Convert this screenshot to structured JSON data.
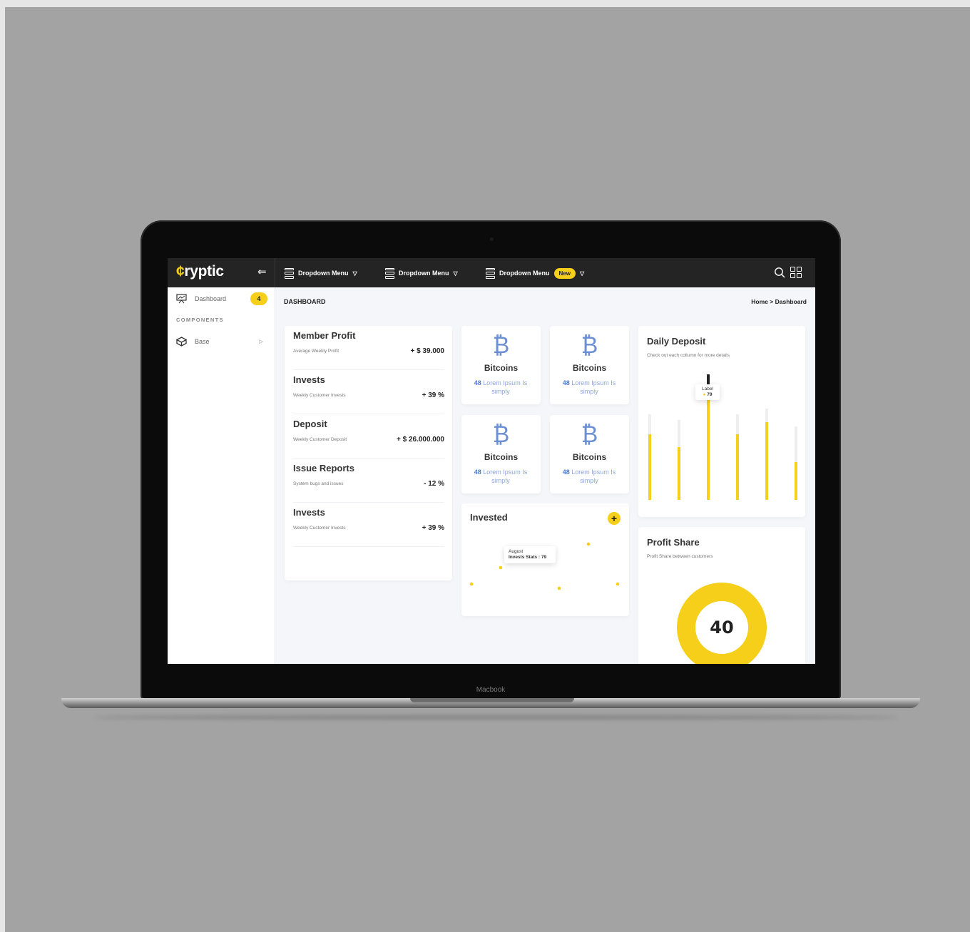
{
  "laptop": {
    "brand": "Macbook"
  },
  "colors": {
    "accent": "#f5cf1a",
    "topbar": "#242424",
    "bitcoin_blue": "#6c8fd4",
    "bar_track": "#eeeeee",
    "bar_selected": "#222222"
  },
  "topbar": {
    "logo_mark": "¢",
    "logo_text": "ryptic",
    "collapse_icon": "arrow-left-icon",
    "menus": [
      {
        "label": "Dropdown Menu",
        "icon": "menu-icon",
        "caret": "▽"
      },
      {
        "label": "Dropdown Menu",
        "icon": "menu-icon",
        "caret": "▽"
      },
      {
        "label": "Dropdown Menu",
        "icon": "menu-icon",
        "caret": "▽",
        "badge": "New"
      }
    ],
    "icons": [
      "search-icon",
      "grid-icon"
    ]
  },
  "sidebar": {
    "items": [
      {
        "label": "Dashboard",
        "icon": "dashboard-icon",
        "badge": "4"
      }
    ],
    "section": "COMPONENTS",
    "components": [
      {
        "label": "Base",
        "icon": "cube-icon",
        "arrow": "▷"
      }
    ]
  },
  "breadcrumb": {
    "title": "DASHBOARD",
    "path": "Home > Dashboard"
  },
  "stats": [
    {
      "title": "Member Profit",
      "subtitle": "Average Weekly Profit",
      "value": "+ $ 39.000"
    },
    {
      "title": "Invests",
      "subtitle": "Weekly Customer Invests",
      "value": "+ 39 %"
    },
    {
      "title": "Deposit",
      "subtitle": "Weekly Customer Deposit",
      "value": "+ $ 26.000.000"
    },
    {
      "title": "Issue Reports",
      "subtitle": "System bugs and issues",
      "value": "- 12 %"
    },
    {
      "title": "Invests",
      "subtitle": "Weekly Customer Invests",
      "value": "+ 39 %"
    }
  ],
  "bitcoin_cards": [
    {
      "symbol": "₿",
      "name": "Bitcoins",
      "number": "48",
      "desc": "Lorem Ipsum Is simply"
    },
    {
      "symbol": "₿",
      "name": "Bitcoins",
      "number": "48",
      "desc": "Lorem Ipsum Is simply"
    },
    {
      "symbol": "₿",
      "name": "Bitcoins",
      "number": "48",
      "desc": "Lorem Ipsum Is simply"
    },
    {
      "symbol": "₿",
      "name": "Bitcoins",
      "number": "48",
      "desc": "Lorem Ipsum Is simply"
    }
  ],
  "invested": {
    "title": "Invested",
    "add_icon": "plus-icon",
    "add_label": "+",
    "tooltip": {
      "month": "August",
      "text": "Invests Stats : 79"
    },
    "chart_data": {
      "type": "scatter",
      "points": [
        0.22,
        0.45,
        0.62,
        0.16,
        0.78,
        0.22
      ],
      "highlight_index": 2
    }
  },
  "daily_deposit": {
    "title": "Daily Deposit",
    "subtitle": "Check out each collumn for more details",
    "tooltip": {
      "label": "Label",
      "value": "79"
    },
    "chart_data": {
      "type": "bar",
      "values": [
        0.52,
        0.42,
        0.82,
        0.52,
        0.62,
        0.3
      ],
      "selected_index": 2
    }
  },
  "profit_share": {
    "title": "Profit Share",
    "subtitle": "Profit Share between customers",
    "value": "40",
    "chart_data": {
      "type": "pie",
      "values": [
        40,
        60
      ]
    }
  }
}
